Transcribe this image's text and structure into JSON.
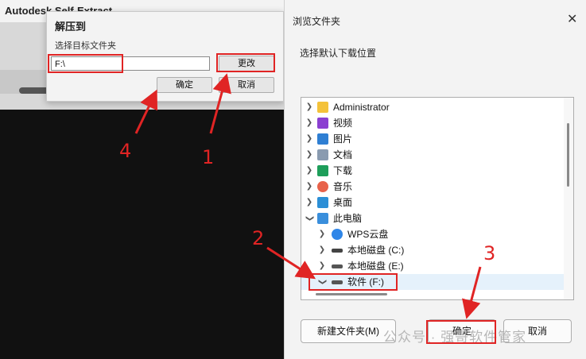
{
  "bg_window": {
    "title": "Autodesk Self-Extract"
  },
  "extract_dialog": {
    "title": "解压到",
    "prompt": "选择目标文件夹",
    "path_value": "F:\\",
    "change_label": "更改",
    "ok_label": "确定",
    "cancel_label": "取消"
  },
  "browse_dialog": {
    "title": "浏览文件夹",
    "close": "✕",
    "prompt": "选择默认下载位置",
    "tree": [
      {
        "label": "Administrator",
        "icon": "folder-icon",
        "color": "#f4c23a"
      },
      {
        "label": "视频",
        "icon": "video-icon",
        "color": "#8b3fd1"
      },
      {
        "label": "图片",
        "icon": "picture-icon",
        "color": "#2f7fd3"
      },
      {
        "label": "文档",
        "icon": "document-icon",
        "color": "#8a9bb0"
      },
      {
        "label": "下载",
        "icon": "download-icon",
        "color": "#1e9e5a"
      },
      {
        "label": "音乐",
        "icon": "music-icon",
        "color": "#e8624a"
      },
      {
        "label": "桌面",
        "icon": "desktop-icon",
        "color": "#2c8fd6"
      },
      {
        "label": "此电脑",
        "icon": "computer-icon",
        "color": "#3a8fdc"
      },
      {
        "label": "WPS云盘",
        "icon": "cloud-icon",
        "color": "#2f86e8"
      },
      {
        "label": "本地磁盘 (C:)",
        "icon": "drive-c-icon",
        "color": "#444444"
      },
      {
        "label": "本地磁盘 (E:)",
        "icon": "drive-icon",
        "color": "#555555"
      },
      {
        "label": "软件 (F:)",
        "icon": "drive-icon",
        "color": "#555555"
      }
    ],
    "new_folder_label": "新建文件夹(M)",
    "ok_label": "确定",
    "cancel_label": "取消"
  },
  "watermark": "公众号 · 强哥软件管家",
  "annotations": {
    "step1": "1",
    "step2": "2",
    "step3": "3",
    "step4": "4",
    "color": "#e02424"
  }
}
